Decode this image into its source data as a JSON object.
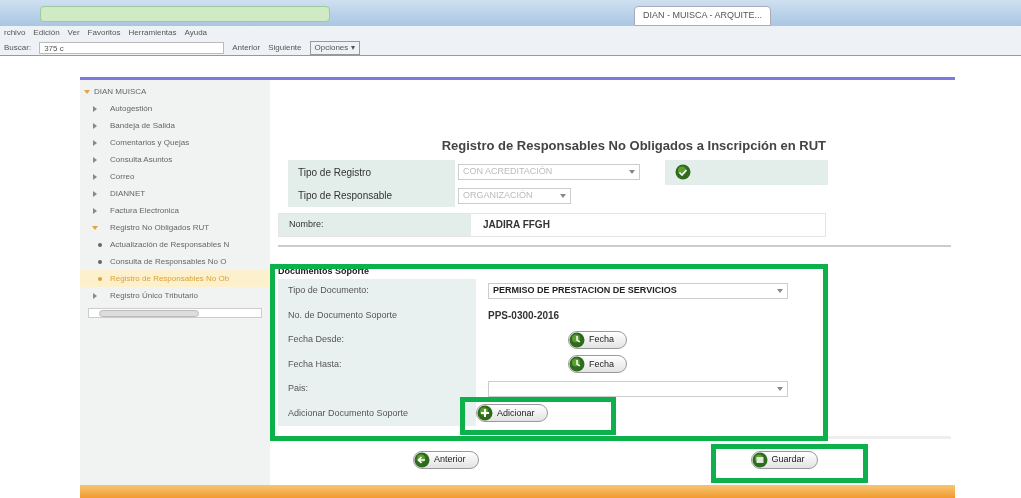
{
  "browser": {
    "tabs": [
      {
        "label": "DIAN - MUISCA - ARQUITE...",
        "selected": true
      }
    ],
    "menu": [
      "rchivo",
      "Edición",
      "Ver",
      "Favoritos",
      "Herramientas",
      "Ayuda"
    ],
    "find_bar": {
      "label": "Buscar:",
      "value": "375 c",
      "buttons": [
        "Anterior",
        "Siguiente",
        "Opciones ▾"
      ]
    }
  },
  "sidebar": {
    "root": {
      "label": "DIAN MUISCA",
      "expanded": true,
      "children": [
        {
          "label": "Autogestión",
          "expanded": false,
          "selected": false
        },
        {
          "label": "Bandeja de Salida",
          "expanded": false,
          "selected": false
        },
        {
          "label": "Comentarios y Quejas",
          "expanded": false,
          "selected": false
        },
        {
          "label": "Consulta Asuntos",
          "expanded": false,
          "selected": false
        },
        {
          "label": "Correo",
          "expanded": false,
          "selected": false
        },
        {
          "label": "DIANNET",
          "expanded": false,
          "selected": false
        },
        {
          "label": "Factura Electronica",
          "expanded": false,
          "selected": false
        },
        {
          "label": "Registro No Obligados RUT",
          "expanded": true,
          "selected": false,
          "children": [
            {
              "label": "Actualización de Responsables N",
              "selected": false
            },
            {
              "label": "Consulta de Responsables No O",
              "selected": false
            },
            {
              "label": "Registro de Responsables No Ob",
              "selected": true
            }
          ]
        },
        {
          "label": "Registro Único Tributario",
          "expanded": false,
          "selected": false
        }
      ]
    }
  },
  "form": {
    "title": "Registro de Responsables No Obligados a Inscripción en RUT",
    "tipo_registro": {
      "label": "Tipo de Registro",
      "value": "CON ACREDITACIÓN",
      "disabled": true
    },
    "tipo_responsable": {
      "label": "Tipo de Responsable",
      "value": "ORGANIZACIÓN",
      "disabled": true
    },
    "nombre": {
      "label": "Nombre:",
      "value": "JADIRA FFGH"
    },
    "section_title": "Documentos Soporte",
    "rows": [
      {
        "kind": "select",
        "label": "Tipo de Documento:",
        "value": "PERMISO DE PRESTACION DE SERVICIOS"
      },
      {
        "kind": "text",
        "label": "No. de Documento Soporte",
        "value": "PPS-0300-2016"
      },
      {
        "kind": "date",
        "label": "Fecha Desde:",
        "button": "Fecha"
      },
      {
        "kind": "date",
        "label": "Fecha Hasta:",
        "button": "Fecha"
      },
      {
        "kind": "select",
        "label": "Pais:",
        "value": ""
      },
      {
        "kind": "add",
        "label": "Adicionar Documento Soporte",
        "button": "Adicionar"
      }
    ],
    "back_button": "Anterior",
    "save_button": "Guardar"
  }
}
